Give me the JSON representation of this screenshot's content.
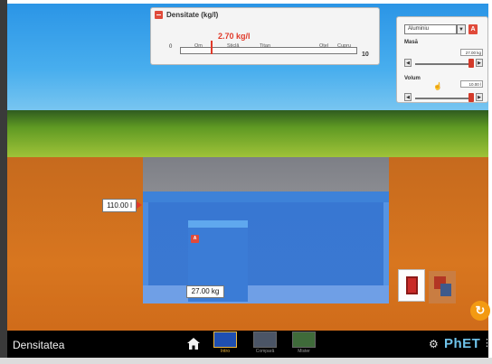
{
  "density_panel": {
    "title": "Densitate  (kg/l)",
    "value": "2.70 kg/l",
    "scale_min": "0",
    "scale_max": "10",
    "reference_labels": [
      "Om",
      "Sticlă",
      "Titan",
      "Oțel",
      "Cupru"
    ]
  },
  "controls": {
    "material": "Aluminiu",
    "dropdown_arrow": "▼",
    "material_badge": "A",
    "mass_label": "Masă",
    "mass_value": "27.00 kg",
    "volume_label": "Volum",
    "volume_value": "10.00 l",
    "decrement_symbol": "◀",
    "increment_symbol": "▶"
  },
  "pool": {
    "volume_readout": "110.00 l",
    "block_badge": "A",
    "block_mass": "27.00 kg"
  },
  "navbar": {
    "app_title": "Densitatea",
    "screens": [
      {
        "label": "Intro",
        "active": true
      },
      {
        "label": "Compară",
        "active": false
      },
      {
        "label": "Mister",
        "active": false
      }
    ],
    "logo": "PhET",
    "menu_glyph": "⋮"
  },
  "icons": {
    "home": "home-icon",
    "gear": "gear-icon",
    "reset": "reset-icon",
    "reset_glyph": "↻",
    "gear_glyph": "⚙"
  },
  "colors": {
    "accent_red": "#e03a2a",
    "water_blue": "#3b78d1",
    "nav_active": "#f2b83a",
    "phet_blue": "#6fc3ea"
  }
}
